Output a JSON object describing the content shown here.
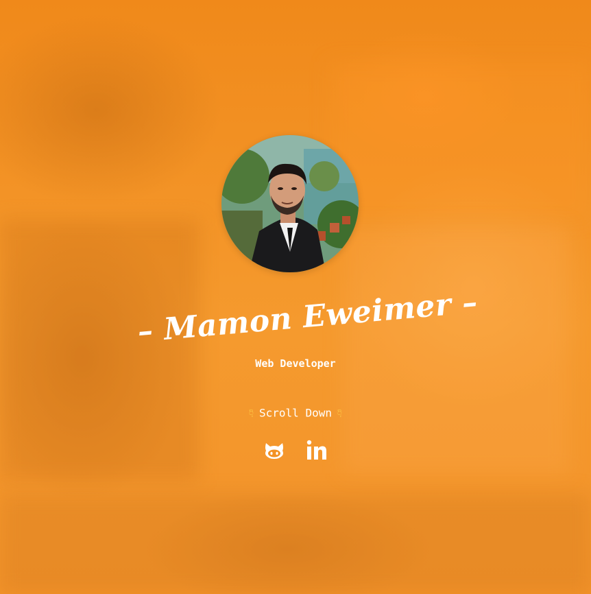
{
  "profile": {
    "name": "Mamon Eweimer",
    "title": "Web Developer",
    "avatar_alt": "profile photo"
  },
  "scroll": {
    "label": "Scroll Down",
    "icon": "pointing-down-hand-icon"
  },
  "social": [
    {
      "name": "github",
      "icon": "github-octocat-icon"
    },
    {
      "name": "linkedin",
      "icon": "linkedin-icon"
    }
  ],
  "colors": {
    "background": "#f39224",
    "text": "#ffffff",
    "hand": "#ffd24a"
  }
}
